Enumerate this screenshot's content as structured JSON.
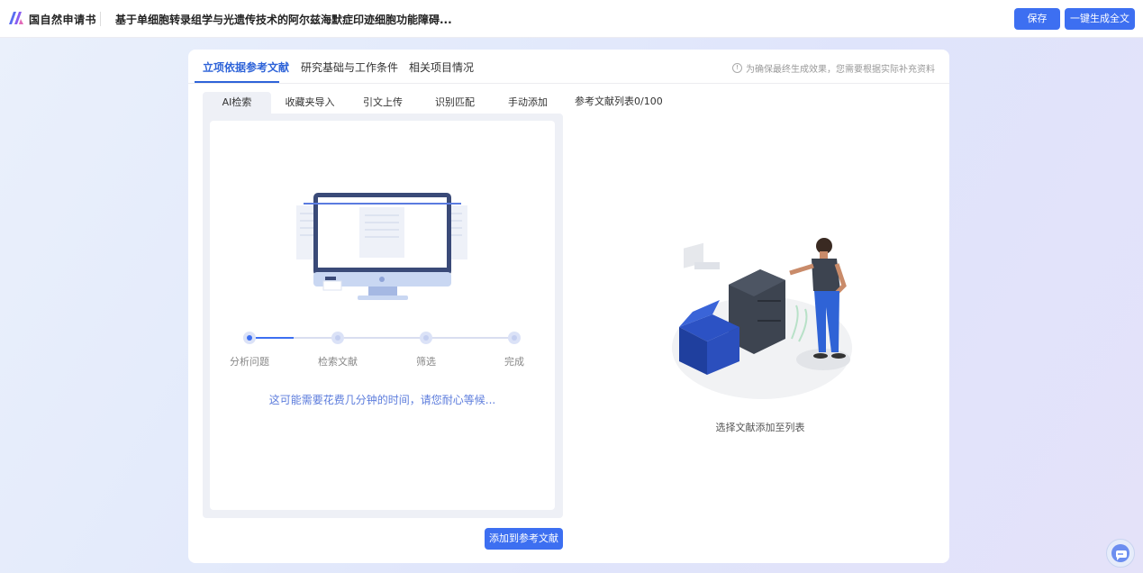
{
  "header": {
    "brand": "国自然申请书",
    "doc_title": "基于单细胞转录组学与光遗传技术的阿尔兹海默症印迹细胞功能障碍...",
    "save_label": "保存",
    "generate_label": "一键生成全文",
    "logo_icon": "brand-logo-icon",
    "accent": "#3d6ff1"
  },
  "tabs": [
    {
      "label": "立项依据参考文献",
      "active": true
    },
    {
      "label": "研究基础与工作条件",
      "active": false
    },
    {
      "label": "相关项目情况",
      "active": false
    }
  ],
  "hint": "为确保最终生成效果，您需要根据实际补充资料",
  "subtabs": [
    {
      "label": "AI检索",
      "active": true
    },
    {
      "label": "收藏夹导入",
      "active": false
    },
    {
      "label": "引文上传",
      "active": false
    },
    {
      "label": "识别匹配",
      "active": false
    },
    {
      "label": "手动添加",
      "active": false
    }
  ],
  "steps": [
    {
      "label": "分析问题",
      "state": "active"
    },
    {
      "label": "检索文献",
      "state": "pending"
    },
    {
      "label": "筛选",
      "state": "pending"
    },
    {
      "label": "完成",
      "state": "pending"
    }
  ],
  "wait_text": "这可能需要花费几分钟的时间，请您耐心等候...",
  "add_button_label": "添加到参考文献",
  "ref_list": {
    "title": "参考文献列表0/100",
    "empty_caption": "选择文献添加至列表"
  }
}
